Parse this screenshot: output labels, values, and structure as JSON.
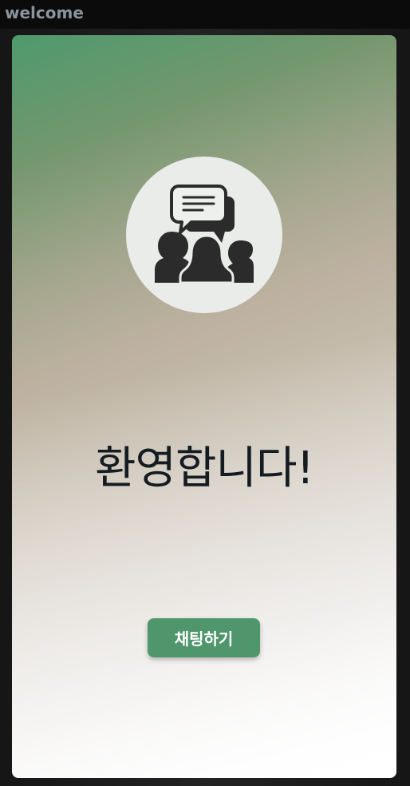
{
  "window": {
    "title": "welcome"
  },
  "main": {
    "icon": "group-chat-icon",
    "heading": "환영합니다!",
    "chat_button_label": "채팅하기"
  },
  "colors": {
    "accent": "#4f966c",
    "heading_text": "#141c22",
    "icon_fill": "#2b2b2b"
  }
}
